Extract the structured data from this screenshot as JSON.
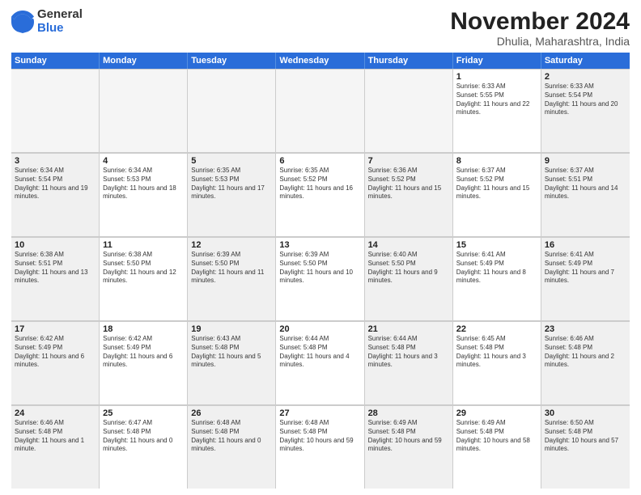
{
  "logo": {
    "general": "General",
    "blue": "Blue"
  },
  "title": "November 2024",
  "location": "Dhulia, Maharashtra, India",
  "days_of_week": [
    "Sunday",
    "Monday",
    "Tuesday",
    "Wednesday",
    "Thursday",
    "Friday",
    "Saturday"
  ],
  "weeks": [
    [
      {
        "day": "",
        "empty": true
      },
      {
        "day": "",
        "empty": true
      },
      {
        "day": "",
        "empty": true
      },
      {
        "day": "",
        "empty": true
      },
      {
        "day": "",
        "empty": true
      },
      {
        "day": "1",
        "sunrise": "Sunrise: 6:33 AM",
        "sunset": "Sunset: 5:55 PM",
        "daylight": "Daylight: 11 hours and 22 minutes."
      },
      {
        "day": "2",
        "sunrise": "Sunrise: 6:33 AM",
        "sunset": "Sunset: 5:54 PM",
        "daylight": "Daylight: 11 hours and 20 minutes."
      }
    ],
    [
      {
        "day": "3",
        "sunrise": "Sunrise: 6:34 AM",
        "sunset": "Sunset: 5:54 PM",
        "daylight": "Daylight: 11 hours and 19 minutes."
      },
      {
        "day": "4",
        "sunrise": "Sunrise: 6:34 AM",
        "sunset": "Sunset: 5:53 PM",
        "daylight": "Daylight: 11 hours and 18 minutes."
      },
      {
        "day": "5",
        "sunrise": "Sunrise: 6:35 AM",
        "sunset": "Sunset: 5:53 PM",
        "daylight": "Daylight: 11 hours and 17 minutes."
      },
      {
        "day": "6",
        "sunrise": "Sunrise: 6:35 AM",
        "sunset": "Sunset: 5:52 PM",
        "daylight": "Daylight: 11 hours and 16 minutes."
      },
      {
        "day": "7",
        "sunrise": "Sunrise: 6:36 AM",
        "sunset": "Sunset: 5:52 PM",
        "daylight": "Daylight: 11 hours and 15 minutes."
      },
      {
        "day": "8",
        "sunrise": "Sunrise: 6:37 AM",
        "sunset": "Sunset: 5:52 PM",
        "daylight": "Daylight: 11 hours and 15 minutes."
      },
      {
        "day": "9",
        "sunrise": "Sunrise: 6:37 AM",
        "sunset": "Sunset: 5:51 PM",
        "daylight": "Daylight: 11 hours and 14 minutes."
      }
    ],
    [
      {
        "day": "10",
        "sunrise": "Sunrise: 6:38 AM",
        "sunset": "Sunset: 5:51 PM",
        "daylight": "Daylight: 11 hours and 13 minutes."
      },
      {
        "day": "11",
        "sunrise": "Sunrise: 6:38 AM",
        "sunset": "Sunset: 5:50 PM",
        "daylight": "Daylight: 11 hours and 12 minutes."
      },
      {
        "day": "12",
        "sunrise": "Sunrise: 6:39 AM",
        "sunset": "Sunset: 5:50 PM",
        "daylight": "Daylight: 11 hours and 11 minutes."
      },
      {
        "day": "13",
        "sunrise": "Sunrise: 6:39 AM",
        "sunset": "Sunset: 5:50 PM",
        "daylight": "Daylight: 11 hours and 10 minutes."
      },
      {
        "day": "14",
        "sunrise": "Sunrise: 6:40 AM",
        "sunset": "Sunset: 5:50 PM",
        "daylight": "Daylight: 11 hours and 9 minutes."
      },
      {
        "day": "15",
        "sunrise": "Sunrise: 6:41 AM",
        "sunset": "Sunset: 5:49 PM",
        "daylight": "Daylight: 11 hours and 8 minutes."
      },
      {
        "day": "16",
        "sunrise": "Sunrise: 6:41 AM",
        "sunset": "Sunset: 5:49 PM",
        "daylight": "Daylight: 11 hours and 7 minutes."
      }
    ],
    [
      {
        "day": "17",
        "sunrise": "Sunrise: 6:42 AM",
        "sunset": "Sunset: 5:49 PM",
        "daylight": "Daylight: 11 hours and 6 minutes."
      },
      {
        "day": "18",
        "sunrise": "Sunrise: 6:42 AM",
        "sunset": "Sunset: 5:49 PM",
        "daylight": "Daylight: 11 hours and 6 minutes."
      },
      {
        "day": "19",
        "sunrise": "Sunrise: 6:43 AM",
        "sunset": "Sunset: 5:48 PM",
        "daylight": "Daylight: 11 hours and 5 minutes."
      },
      {
        "day": "20",
        "sunrise": "Sunrise: 6:44 AM",
        "sunset": "Sunset: 5:48 PM",
        "daylight": "Daylight: 11 hours and 4 minutes."
      },
      {
        "day": "21",
        "sunrise": "Sunrise: 6:44 AM",
        "sunset": "Sunset: 5:48 PM",
        "daylight": "Daylight: 11 hours and 3 minutes."
      },
      {
        "day": "22",
        "sunrise": "Sunrise: 6:45 AM",
        "sunset": "Sunset: 5:48 PM",
        "daylight": "Daylight: 11 hours and 3 minutes."
      },
      {
        "day": "23",
        "sunrise": "Sunrise: 6:46 AM",
        "sunset": "Sunset: 5:48 PM",
        "daylight": "Daylight: 11 hours and 2 minutes."
      }
    ],
    [
      {
        "day": "24",
        "sunrise": "Sunrise: 6:46 AM",
        "sunset": "Sunset: 5:48 PM",
        "daylight": "Daylight: 11 hours and 1 minute."
      },
      {
        "day": "25",
        "sunrise": "Sunrise: 6:47 AM",
        "sunset": "Sunset: 5:48 PM",
        "daylight": "Daylight: 11 hours and 0 minutes."
      },
      {
        "day": "26",
        "sunrise": "Sunrise: 6:48 AM",
        "sunset": "Sunset: 5:48 PM",
        "daylight": "Daylight: 11 hours and 0 minutes."
      },
      {
        "day": "27",
        "sunrise": "Sunrise: 6:48 AM",
        "sunset": "Sunset: 5:48 PM",
        "daylight": "Daylight: 10 hours and 59 minutes."
      },
      {
        "day": "28",
        "sunrise": "Sunrise: 6:49 AM",
        "sunset": "Sunset: 5:48 PM",
        "daylight": "Daylight: 10 hours and 59 minutes."
      },
      {
        "day": "29",
        "sunrise": "Sunrise: 6:49 AM",
        "sunset": "Sunset: 5:48 PM",
        "daylight": "Daylight: 10 hours and 58 minutes."
      },
      {
        "day": "30",
        "sunrise": "Sunrise: 6:50 AM",
        "sunset": "Sunset: 5:48 PM",
        "daylight": "Daylight: 10 hours and 57 minutes."
      }
    ]
  ]
}
